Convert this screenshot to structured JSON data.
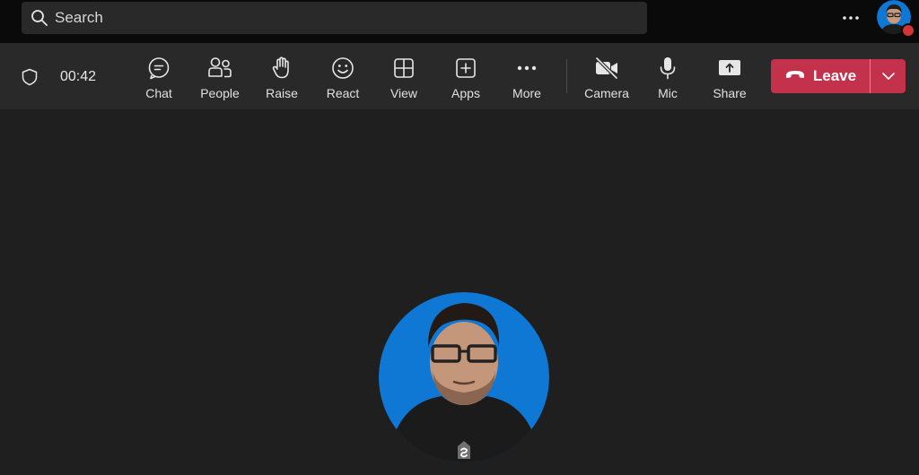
{
  "search": {
    "label": "Search"
  },
  "header": {
    "more_icon": "more-horizontal-icon",
    "avatar_icon": "user-avatar",
    "presence_color": "#d13438"
  },
  "call": {
    "timer": "00:42",
    "controls": [
      {
        "label": "Chat",
        "icon": "chat-icon"
      },
      {
        "label": "People",
        "icon": "people-icon"
      },
      {
        "label": "Raise",
        "icon": "raise-hand-icon"
      },
      {
        "label": "React",
        "icon": "react-smiley-icon"
      },
      {
        "label": "View",
        "icon": "view-grid-icon"
      },
      {
        "label": "Apps",
        "icon": "apps-add-icon"
      },
      {
        "label": "More",
        "icon": "more-horizontal-icon"
      },
      {
        "label": "Camera",
        "icon": "camera-off-icon"
      },
      {
        "label": "Mic",
        "icon": "mic-icon"
      },
      {
        "label": "Share",
        "icon": "share-screen-icon"
      }
    ],
    "leave_label": "Leave",
    "leave_color": "#c4314b"
  },
  "colors": {
    "topbar": "#0a0a0a",
    "controlbar": "#292929",
    "stage": "#1f1f1f",
    "avatar_bg": "#0f78d4"
  }
}
